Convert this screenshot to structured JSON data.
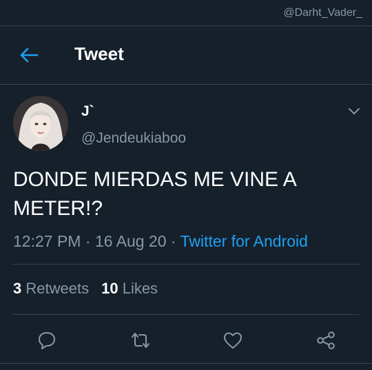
{
  "watermark": "@Darht_Vader_",
  "header": {
    "title": "Tweet",
    "back_icon": "arrow-left-icon"
  },
  "tweet": {
    "display_name": "J`",
    "username": "@Jendeukiaboo",
    "text": "DONDE MIERDAS ME VINE A METER!?",
    "time": "12:27 PM",
    "date": "16 Aug 20",
    "separator": "·",
    "source": "Twitter for Android",
    "menu_icon": "chevron-down-icon"
  },
  "stats": {
    "retweets_count": "3",
    "retweets_label": "Retweets",
    "likes_count": "10",
    "likes_label": "Likes"
  },
  "actions": [
    "reply-icon",
    "retweet-icon",
    "like-icon",
    "share-icon"
  ],
  "colors": {
    "background": "#15202b",
    "accent": "#1da1f2",
    "muted": "#8899a6",
    "divider": "#38444d"
  }
}
